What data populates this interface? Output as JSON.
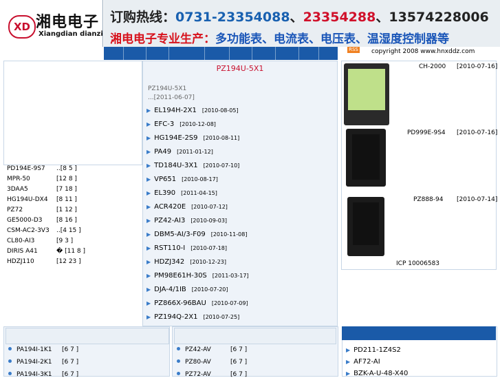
{
  "header": {
    "logo_mark": "XD",
    "logo_cn": "湘电电子",
    "logo_en": "Xiangdian dianzi",
    "hotline_label": "订购热线：",
    "phone1": "0731-23354088",
    "sep1": "、",
    "phone2": "23354288",
    "sep2": "、",
    "phone3": "13574228006",
    "slogan_a": "湘电电子专业生产：",
    "slogan_b": "多功能表、电流表、电压表、温湿度控制器等",
    "rss": "RSS",
    "copyright": "copyright 2008  www.hnxddz.com"
  },
  "left_list": [
    {
      "name": "PD194E-9S7",
      "count": "..[8 5 ]"
    },
    {
      "name": "MPR-50",
      "count": "[12 8 ]"
    },
    {
      "name": "3DAA5",
      "count": "[7 18 ]"
    },
    {
      "name": "HG194U-DX4",
      "count": "[8 11 ]"
    },
    {
      "name": "PZ72",
      "count": "[1 12 ]"
    },
    {
      "name": "GE5000-D3",
      "count": "[8 16 ]"
    },
    {
      "name": "CSM-AC2-3V3",
      "count": "..[4 15 ]"
    },
    {
      "name": "CL80-AI3",
      "count": "[9 3 ]"
    },
    {
      "name": "DIRIS A41",
      "count": "� [11 8 ]"
    },
    {
      "name": "HDZJ110",
      "count": "[12 23 ]"
    }
  ],
  "middle": {
    "title": "PZ194U-5X1",
    "sub1": "PZ194U-5X1",
    "sub2": "...[2011-06-07]",
    "items": [
      {
        "name": "EL194H-2X1",
        "date": "[2010-08-05]"
      },
      {
        "name": "EFC-3",
        "date": "[2010-12-08]"
      },
      {
        "name": "HG194E-2S9",
        "date": "[2010-08-11]"
      },
      {
        "name": "PA49",
        "date": "[2011-01-12]"
      },
      {
        "name": "TD184U-3X1",
        "date": "[2010-07-10]"
      },
      {
        "name": "VP651",
        "date": "[2010-08-17]"
      },
      {
        "name": "EL390",
        "date": "[2011-04-15]"
      },
      {
        "name": "ACR420E",
        "date": "[2010-07-12]"
      },
      {
        "name": "PZ42-AI3",
        "date": "[2010-09-03]"
      },
      {
        "name": "DBM5-AI/3-F09",
        "date": "[2010-11-08]"
      },
      {
        "name": "RST110-I",
        "date": "[2010-07-18]"
      },
      {
        "name": "HDZJ342",
        "date": "[2010-12-23]"
      },
      {
        "name": "PM98E61H-30S",
        "date": "[2011-03-17]"
      },
      {
        "name": "DJA-4/1IB",
        "date": "[2010-07-20]"
      },
      {
        "name": "PZ866X-96BAU",
        "date": "[2010-07-09]"
      },
      {
        "name": "PZ194Q-2X1",
        "date": "[2010-07-25]"
      }
    ]
  },
  "right": {
    "products": [
      {
        "name": "CH-2000",
        "date": "[2010-07-16]"
      },
      {
        "name": "PD999E-9S4",
        "date": "[2010-07-16]"
      },
      {
        "name": "PZ888-94",
        "date": "[2010-07-14]"
      }
    ],
    "icp": "ICP 10006583"
  },
  "bottom_left": [
    {
      "name": "PA194I-1K1",
      "count": "[6 7 ]"
    },
    {
      "name": "PA194I-2K1",
      "count": "[6 7 ]"
    },
    {
      "name": "PA194I-3K1",
      "count": "[6 7 ]"
    }
  ],
  "bottom_mid": [
    {
      "name": "PZ42-AV",
      "count": "[6 7 ]"
    },
    {
      "name": "PZ80-AV",
      "count": "[6 7 ]"
    },
    {
      "name": "PZ72-AV",
      "count": "[6 7 ]"
    }
  ],
  "bottom_right": [
    {
      "name": "PD211-1Z4S2"
    },
    {
      "name": "AF72-AI"
    },
    {
      "name": "BZK-A-U-48-X40"
    }
  ],
  "colors": {
    "brand_red": "#c8102e",
    "nav_blue": "#1a5aa8",
    "panel_bg": "#eef3f9"
  }
}
